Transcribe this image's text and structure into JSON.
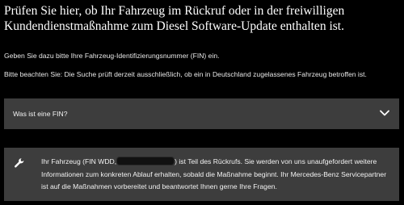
{
  "heading": "Prüfen Sie hier, ob Ihr Fahrzeug im Rückruf oder in der freiwilligen Kundendienstmaßnahme zum Diesel Software-Update enthalten ist.",
  "intro": "Geben Sie dazu bitte Ihre Fahrzeug-Identifizierungsnummer (FIN) ein.",
  "notice": "Bitte beachten Sie: Die Suche prüft derzeit ausschließlich, ob ein in Deutschland zugelassenes Fahrzeug betroffen ist.",
  "accordion": {
    "label": "Was ist eine FIN?",
    "icon": "chevron-down-icon"
  },
  "result": {
    "icon": "wrench-icon",
    "text_before": "Ihr Fahrzeug (FIN WDD,",
    "text_after": ") ist Teil des Rückrufs. Sie werden von uns unaufgefordert weitere Informationen zum konkreten Ablauf erhalten, sobald die Maßnahme beginnt. Ihr Mercedes-Benz Servicepartner ist auf die Maßnahmen vorbereitet und beantwortet Ihnen gerne Ihre Fragen."
  }
}
